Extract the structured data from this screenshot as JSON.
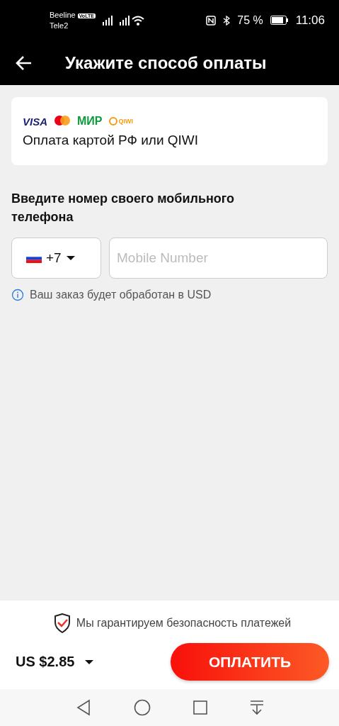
{
  "status_bar": {
    "carrier_1": "Beeline",
    "carrier_1_badge": "VoLTE",
    "carrier_2": "Tele2",
    "battery": "75 %",
    "time": "11:06"
  },
  "header": {
    "title": "Укажите способ оплаты"
  },
  "payment_method": {
    "logos": [
      {
        "kind": "visa",
        "text": "VISA"
      },
      {
        "kind": "mastercard"
      },
      {
        "kind": "mir",
        "text": "МИР"
      },
      {
        "kind": "qiwi",
        "text": "QIWI"
      }
    ],
    "label": "Оплата картой РФ или QIWI"
  },
  "phone": {
    "heading": "Введите номер своего мобильного телефона",
    "country_code": "+7",
    "placeholder": "Mobile Number",
    "note": "Ваш заказ будет обработан в USD"
  },
  "footer": {
    "guarantee": "Мы гарантируем безопасность платежей",
    "total": "US $2.85",
    "pay_button": "ОПЛАТИТЬ"
  }
}
